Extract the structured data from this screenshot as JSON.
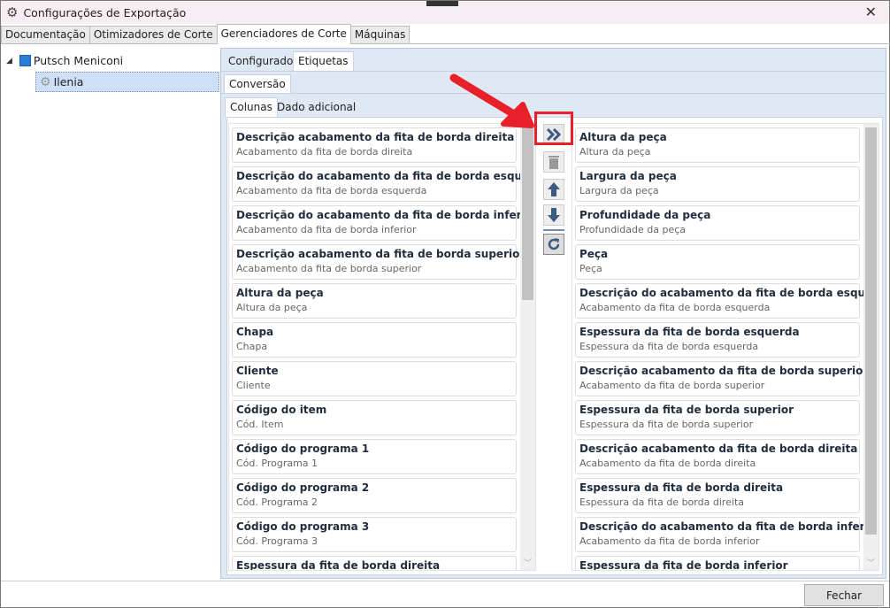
{
  "window": {
    "title": "Configurações de Exportação",
    "close": "✕"
  },
  "tabs": [
    "Documentação",
    "Otimizadores de Corte",
    "Gerenciadores de Corte",
    "Máquinas"
  ],
  "tree": {
    "root": "Putsch Meniconi",
    "child": "Ilenia"
  },
  "subtabs": [
    "Configurador",
    "Etiquetas"
  ],
  "conversion_tab": "Conversão",
  "inner_tabs": [
    "Colunas",
    "Dado adicional"
  ],
  "left_list": [
    {
      "title": "Descrição acabamento da fita de borda direita",
      "sub": "Acabamento da fita de borda direita"
    },
    {
      "title": "Descrição do acabamento da fita de borda esquerda",
      "sub": "Acabamento da fita de borda esquerda"
    },
    {
      "title": "Descrição do acabamento da fita de borda inferior",
      "sub": "Acabamento da fita de borda inferior"
    },
    {
      "title": "Descrição acabamento da fita de borda superior",
      "sub": "Acabamento da fita de borda superior"
    },
    {
      "title": "Altura da peça",
      "sub": "Altura da peça"
    },
    {
      "title": "Chapa",
      "sub": "Chapa"
    },
    {
      "title": "Cliente",
      "sub": "Cliente"
    },
    {
      "title": "Código do item",
      "sub": "Cód. Item"
    },
    {
      "title": "Código do programa 1",
      "sub": "Cód. Programa 1"
    },
    {
      "title": "Código do programa 2",
      "sub": "Cód. Programa 2"
    },
    {
      "title": "Código do programa 3",
      "sub": "Cód. Programa 3"
    },
    {
      "title": "Espessura da fita de borda direita",
      "sub": ""
    }
  ],
  "right_list": [
    {
      "title": "Altura da peça",
      "sub": "Altura da peça"
    },
    {
      "title": "Largura da peça",
      "sub": "Largura da peça"
    },
    {
      "title": "Profundidade da peça",
      "sub": "Profundidade da peça"
    },
    {
      "title": "Peça",
      "sub": "Peça"
    },
    {
      "title": "Descrição do acabamento da fita de borda esquerda",
      "sub": "Acabamento da fita de borda esquerda"
    },
    {
      "title": "Espessura da fita de borda esquerda",
      "sub": "Espessura da fita de borda esquerda"
    },
    {
      "title": "Descrição acabamento da fita de borda superior",
      "sub": "Acabamento da fita de borda superior"
    },
    {
      "title": "Espessura da fita de borda superior",
      "sub": "Espessura da fita de borda superior"
    },
    {
      "title": "Descrição acabamento da fita de borda direita",
      "sub": "Acabamento da fita de borda direita"
    },
    {
      "title": "Espessura da fita de borda direita",
      "sub": "Espessura da fita de borda direita"
    },
    {
      "title": "Descrição do acabamento da fita de borda inferior",
      "sub": "Acabamento da fita de borda inferior"
    },
    {
      "title": "Espessura da fita de borda inferior",
      "sub": ""
    }
  ],
  "buttons": {
    "close": "Fechar"
  },
  "colors": {
    "accent": "#3c5a80",
    "highlight": "#e8202a",
    "panel": "#dfe8f3"
  }
}
